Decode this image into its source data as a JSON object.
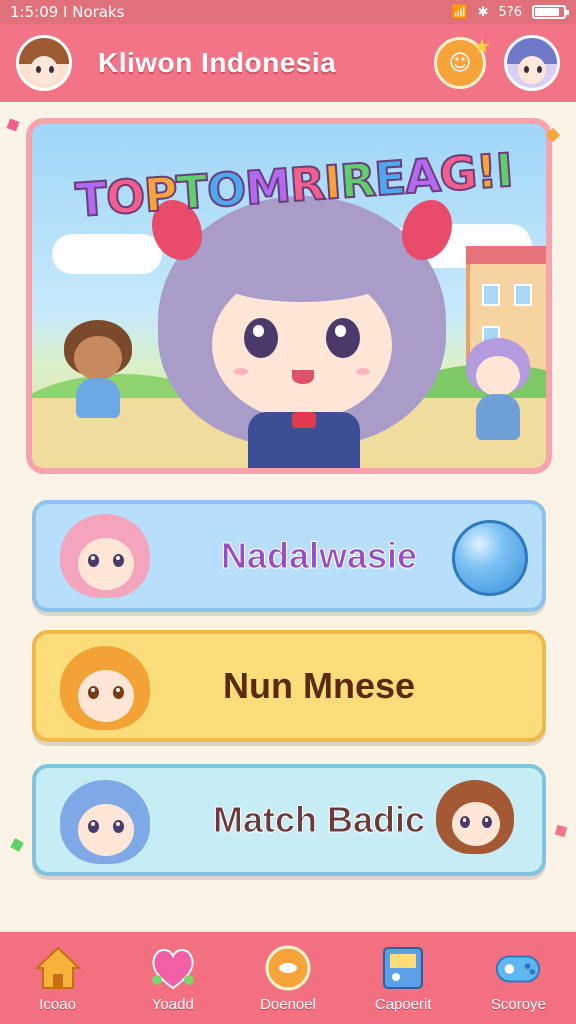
{
  "status_bar": {
    "time_carrier": "1:5:09 I Noraks",
    "network_label": "5?6"
  },
  "header": {
    "title": "Kliwon Indonesia",
    "coin_icon": "coin-icon",
    "accent_color": "#f27486"
  },
  "banner": {
    "title_letters": [
      "T",
      "O",
      "P",
      "T",
      "O",
      "M",
      "R",
      "I",
      "R",
      "E",
      "A",
      "G",
      "!",
      "I"
    ],
    "title_text": "TOPTOMRIREAG!I"
  },
  "menu": [
    {
      "label": "Nadalwasie",
      "color": "#b7defa"
    },
    {
      "label": "Nun Mnese",
      "color": "#fbde7a"
    },
    {
      "label": "Match Badic",
      "color": "#c6ecf6"
    }
  ],
  "bottom_nav": [
    {
      "label": "Icoao",
      "icon": "home-icon"
    },
    {
      "label": "Yoadd",
      "icon": "heart-icon"
    },
    {
      "label": "Doenoel",
      "icon": "food-icon"
    },
    {
      "label": "Capoerit",
      "icon": "book-icon"
    },
    {
      "label": "Scoroye",
      "icon": "controller-icon"
    }
  ],
  "battery_level": 0.85
}
